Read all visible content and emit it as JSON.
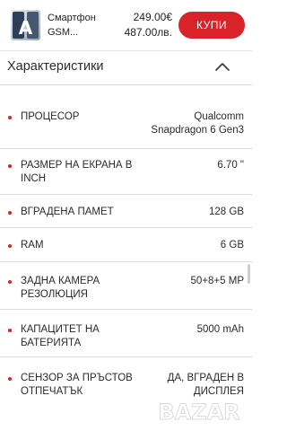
{
  "product_bar": {
    "name_line1": "Смартфон",
    "name_line2": "GSM...",
    "price_eur": "249.00€",
    "price_bgn": "487.00лв.",
    "buy_label": "КУПИ",
    "buy_color": "#d9222a"
  },
  "section": {
    "title": "Характеристики",
    "toggle_icon": "chevron-up-icon"
  },
  "specs": [
    {
      "label_1": "ПРОЦЕСОР",
      "label_2": "",
      "value_1": "Qualcomm",
      "value_2": "Snapdragon 6 Gen3"
    },
    {
      "label_1": "РАЗМЕР НА ЕКРАНА В",
      "label_2": "INCH",
      "value_1": "6.70 \"",
      "value_2": ""
    },
    {
      "label_1": "ВГРАДЕНА ПАМЕТ",
      "label_2": "",
      "value_1": "128 GB",
      "value_2": ""
    },
    {
      "label_1": "RAM",
      "label_2": "",
      "value_1": "6 GB",
      "value_2": ""
    },
    {
      "label_1": "ЗАДНА КАМЕРА",
      "label_2": "РЕЗОЛЮЦИЯ",
      "value_1": "50+8+5 MP",
      "value_2": ""
    },
    {
      "label_1": "КАПАЦИТЕТ НА",
      "label_2": "БАТЕРИЯТА",
      "value_1": "5000 mAh",
      "value_2": ""
    },
    {
      "label_1": "СЕНЗОР ЗА ПРЪСТОВ",
      "label_2": "ОТПЕЧАТЪК",
      "value_1": "ДА, ВГРАДЕН В",
      "value_2": "ДИСПЛЕЯ"
    }
  ],
  "watermark": {
    "text": "BAZAR"
  },
  "accent_color": "#d9222a"
}
